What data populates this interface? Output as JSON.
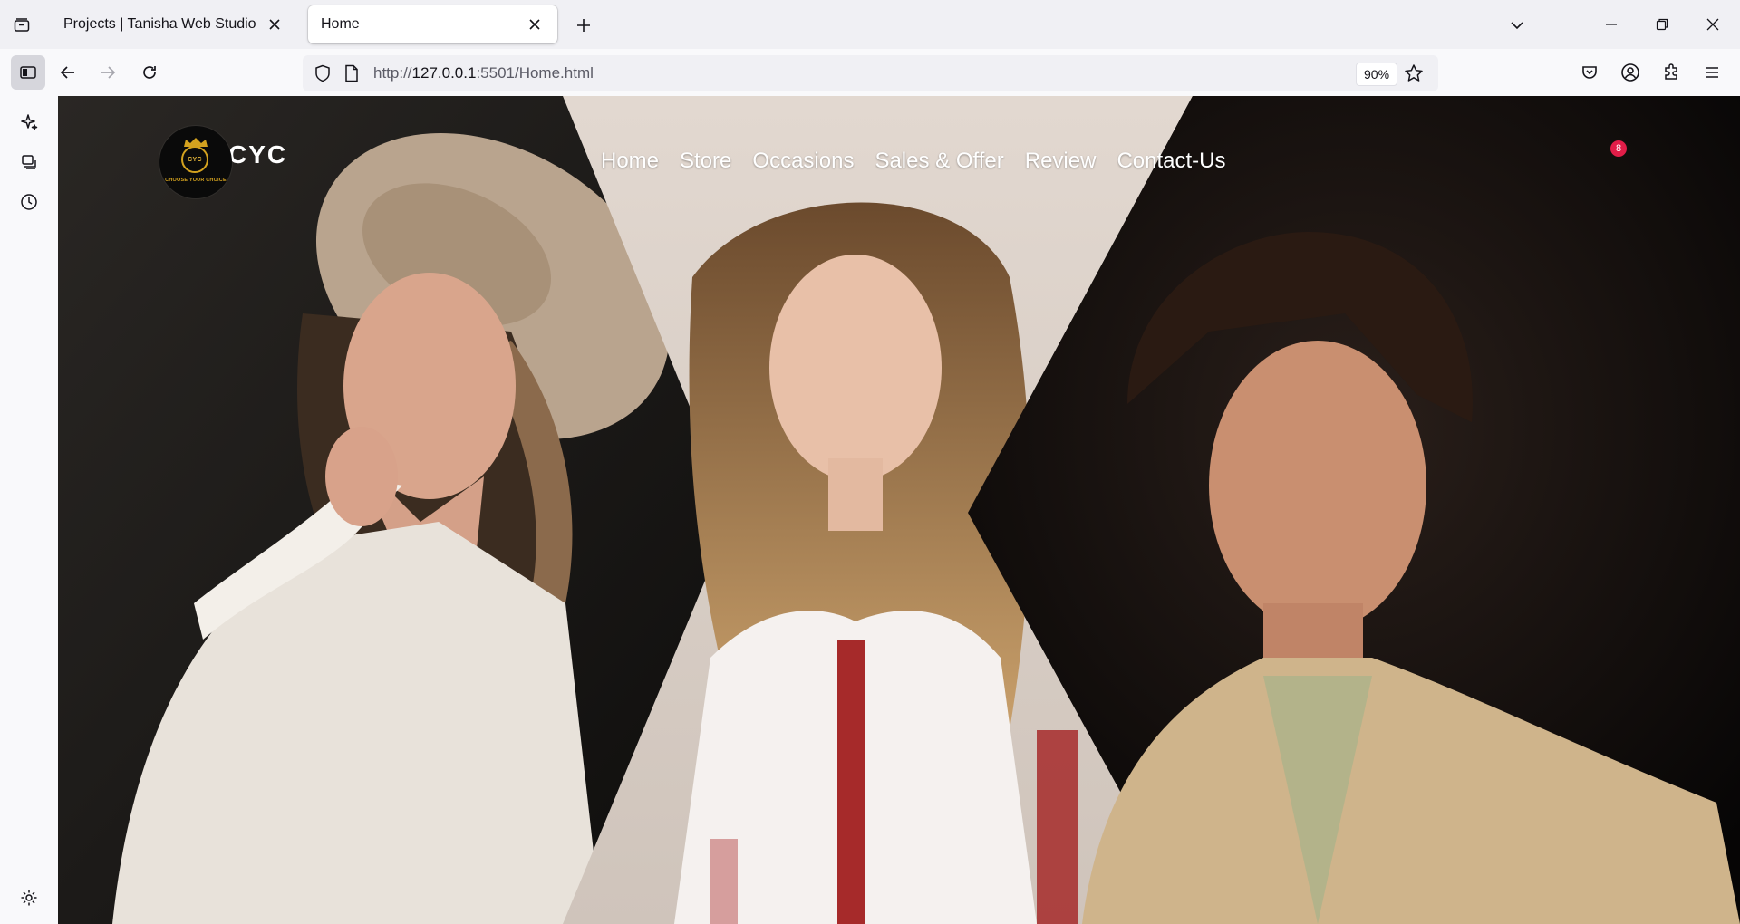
{
  "browser": {
    "tabs": [
      {
        "title": "Projects | Tanisha Web Studio",
        "active": false
      },
      {
        "title": "Home",
        "active": true
      }
    ],
    "url": {
      "scheme": "http://",
      "host": "127.0.0.1",
      "rest": ":5501/Home.html"
    },
    "zoom": "90%"
  },
  "site": {
    "brand": "CYC",
    "logo_mark": "CYC",
    "logo_tagline": "CHOOSE YOUR CHOICE",
    "nav": [
      "Home",
      "Store",
      "Occasions",
      "Sales & Offer",
      "Review",
      "Contact-Us"
    ],
    "cart_count": "8"
  },
  "colors": {
    "accent_badge": "#e11d48",
    "logo_gold": "#d4a21f",
    "hero_left_bg": "#1a1816",
    "hero_center_bg": "#ddd3cc",
    "hero_right_bg": "#0c0a0a"
  },
  "icons": [
    "tab-list-icon",
    "close-icon",
    "plus-icon",
    "chevron-down-icon",
    "minimize-icon",
    "restore-icon",
    "sidebar-icon",
    "back-arrow-icon",
    "forward-arrow-icon",
    "reload-icon",
    "shield-icon",
    "page-icon",
    "star-icon",
    "pocket-icon",
    "account-icon",
    "extensions-icon",
    "menu-icon",
    "ai-sparkle-icon",
    "synced-tabs-icon",
    "history-icon",
    "gear-icon"
  ]
}
